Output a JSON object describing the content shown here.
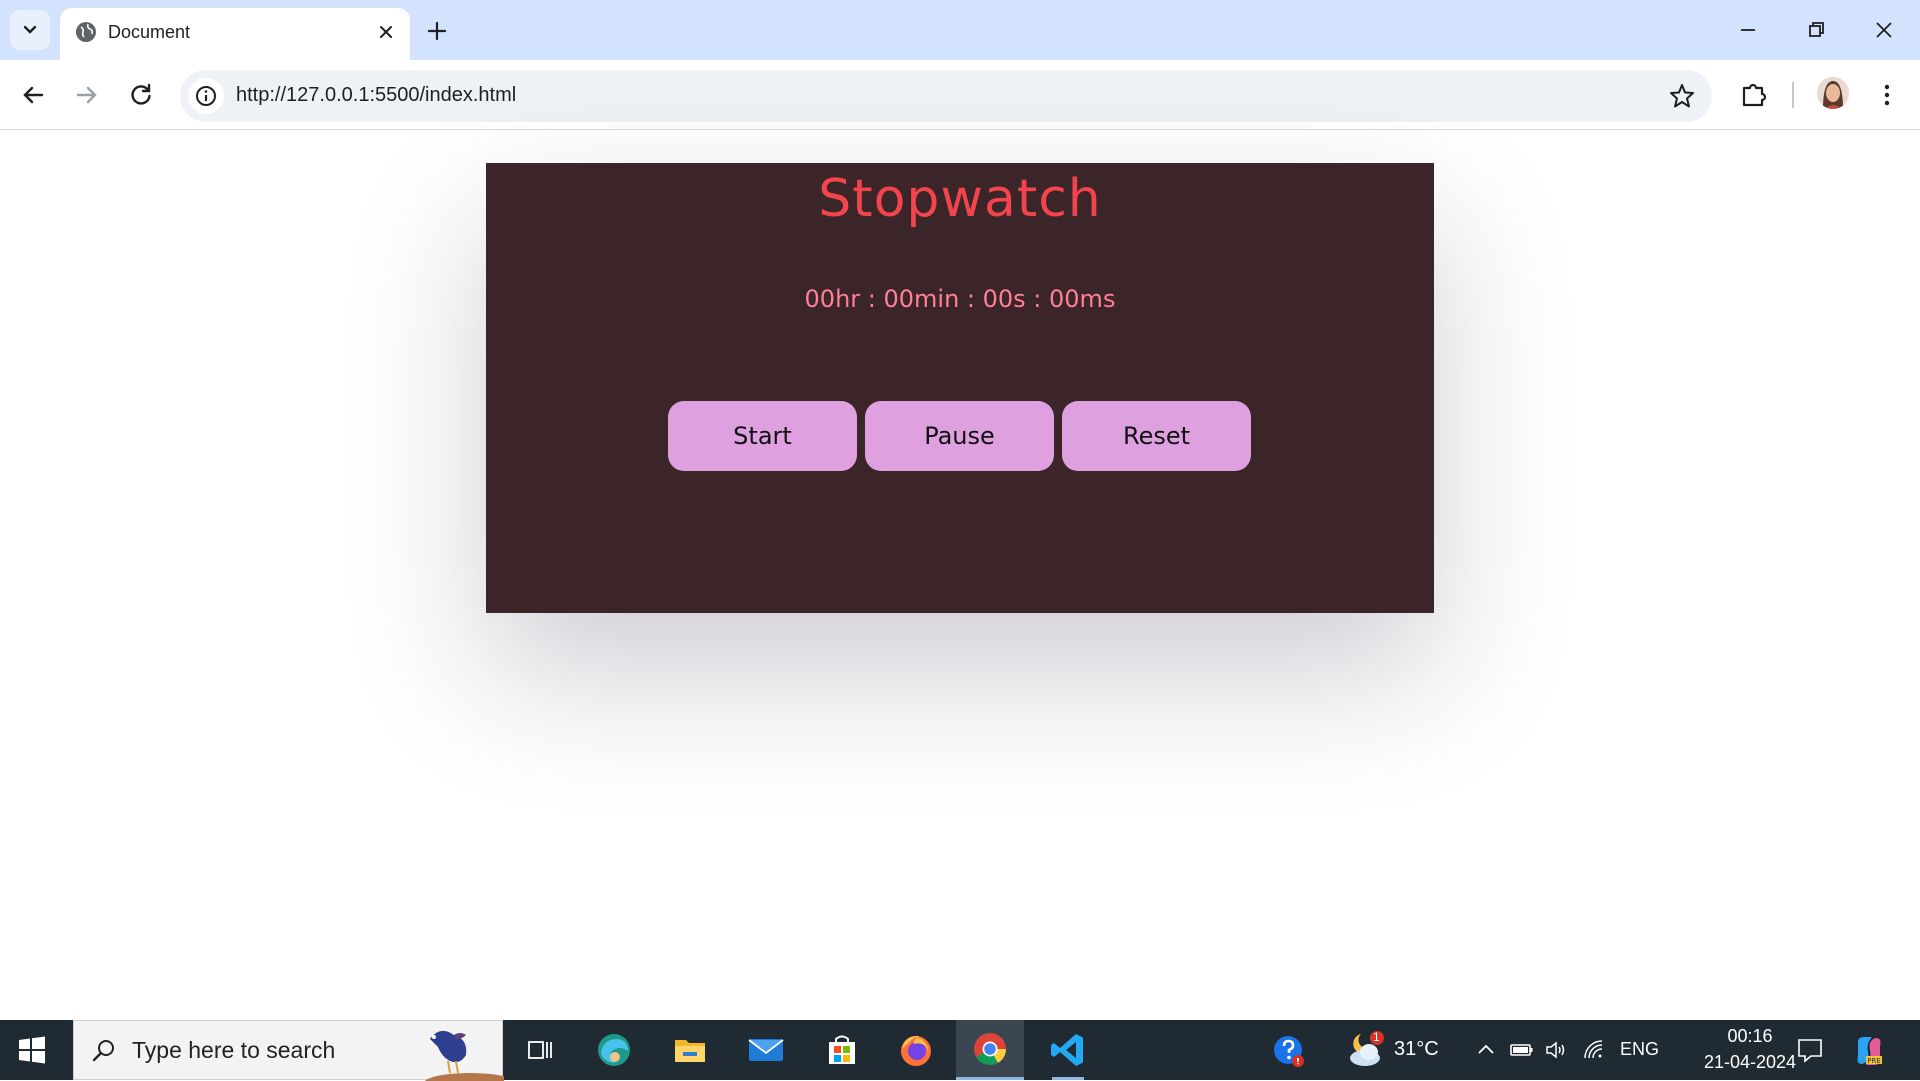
{
  "browser": {
    "tab_title": "Document",
    "url": "http://127.0.0.1:5500/index.html"
  },
  "stopwatch": {
    "title": "Stopwatch",
    "display": "00hr : 00min : 00s : 00ms",
    "buttons": {
      "start": "Start",
      "pause": "Pause",
      "reset": "Reset"
    },
    "colors": {
      "card_bg": "#3b2528",
      "title": "#f2444c",
      "display": "#ff7f98",
      "button_bg": "#dea0df"
    }
  },
  "taskbar": {
    "search_placeholder": "Type here to search",
    "weather_temp": "31°C",
    "weather_badge": "1",
    "language": "ENG",
    "time": "00:16",
    "date": "21-04-2024",
    "apps": [
      "task-view-icon",
      "edge-icon",
      "file-explorer-icon",
      "mail-icon",
      "microsoft-store-icon",
      "firefox-icon",
      "chrome-icon",
      "vscode-icon"
    ]
  }
}
